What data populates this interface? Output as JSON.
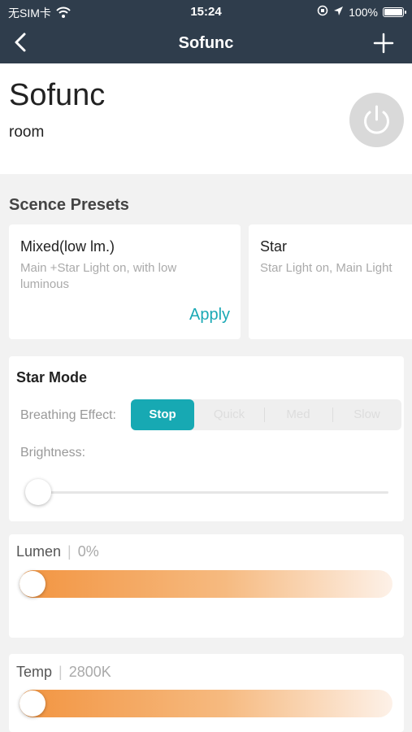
{
  "status": {
    "carrier": "无SIM卡",
    "time": "15:24",
    "battery": "100%"
  },
  "nav": {
    "title": "Sofunc"
  },
  "device": {
    "name": "Sofunc",
    "room": "room"
  },
  "presets": {
    "title": "Scence Presets",
    "items": [
      {
        "name": "Mixed(low lm.)",
        "desc": "Main +Star Light on, with low luminous",
        "action": "Apply"
      },
      {
        "name": "Star",
        "desc": "Star Light on, Main Light"
      }
    ]
  },
  "star_mode": {
    "title": "Star Mode",
    "breathing_label": "Breathing Effect:",
    "options": [
      "Stop",
      "Quick",
      "Med",
      "Slow"
    ],
    "selected": "Stop",
    "brightness_label": "Brightness:",
    "brightness_value": 0
  },
  "lumen": {
    "label": "Lumen",
    "value": "0%",
    "level": 0
  },
  "temp": {
    "label": "Temp",
    "value": "2800K",
    "level": 0
  },
  "colors": {
    "nav_bg": "#2f3d4c",
    "accent": "#17a9b3",
    "slider_orange": "#f29440"
  },
  "icons": [
    "back-chevron-icon",
    "plus-icon",
    "power-icon",
    "wifi-icon",
    "location-arrow-icon",
    "lock-rotation-icon",
    "battery-icon"
  ]
}
